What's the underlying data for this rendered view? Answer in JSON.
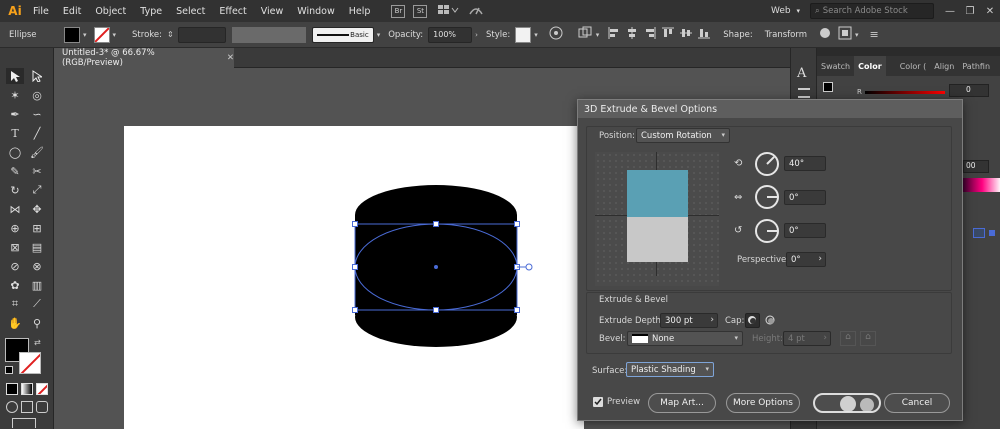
{
  "menubar": {
    "logo": "Ai",
    "items": [
      "File",
      "Edit",
      "Object",
      "Type",
      "Select",
      "Effect",
      "View",
      "Window",
      "Help"
    ],
    "app_icons": [
      "Br",
      "St"
    ],
    "workspace": "Web",
    "search_placeholder": "Search Adobe Stock"
  },
  "controlbar": {
    "selection_label": "Ellipse",
    "stroke_label": "Stroke:",
    "brush_label": "Basic",
    "opacity_label": "Opacity:",
    "opacity_value": "100%",
    "style_label": "Style:",
    "shape_label": "Shape:",
    "transform_label": "Transform"
  },
  "document": {
    "tab_title": "Untitled-3* @ 66.67% (RGB/Preview)"
  },
  "panels": {
    "tabs": [
      "Swatch",
      "Color",
      "Color (",
      "Align",
      "Pathfin"
    ],
    "active_tab": "Color",
    "channel_label": "R",
    "channel_value": "0",
    "partial_value": "00"
  },
  "dialog": {
    "title": "3D Extrude & Bevel Options",
    "position_label": "Position:",
    "position_value": "Custom Rotation",
    "rotation_x": "40°",
    "rotation_y": "0°",
    "rotation_z": "0°",
    "perspective_label": "Perspective:",
    "perspective_value": "0°",
    "extrude_group_label": "Extrude & Bevel",
    "extrude_depth_label": "Extrude Depth:",
    "extrude_depth_value": "300 pt",
    "cap_label": "Cap:",
    "bevel_label": "Bevel:",
    "bevel_value": "None",
    "height_label": "Height:",
    "height_value": "4 pt",
    "surface_label": "Surface:",
    "surface_value": "Plastic Shading",
    "preview_label": "Preview",
    "map_art_label": "Map Art...",
    "more_options_label": "More Options",
    "ok_label": "OK",
    "cancel_label": "Cancel"
  },
  "colors": {
    "cube_front": "#5aa0b4",
    "cube_bottom": "#c8c8c8",
    "selection": "#4a6bd6",
    "orange_accent": "#f7a11a"
  }
}
